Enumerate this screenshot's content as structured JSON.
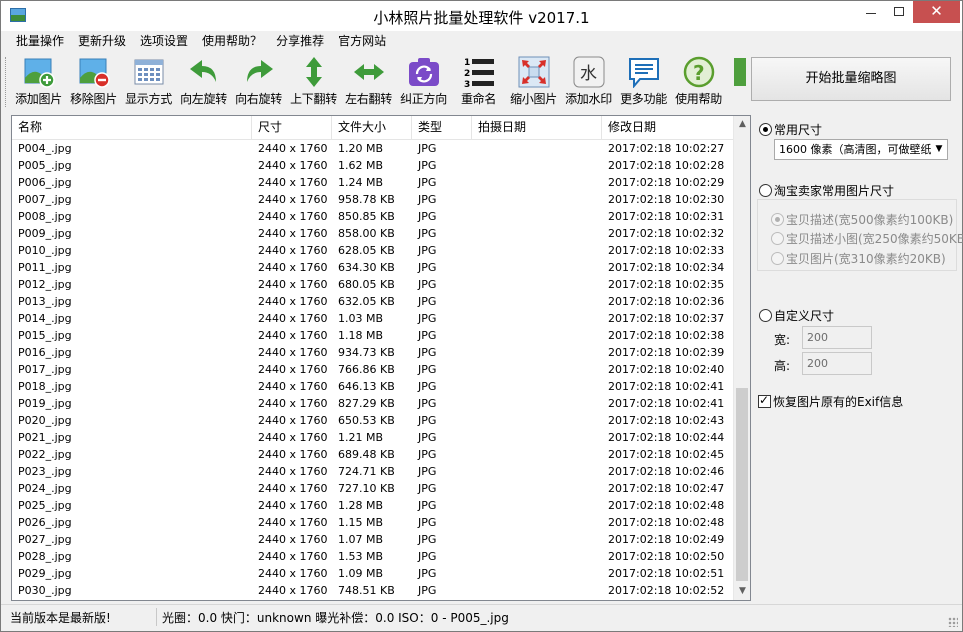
{
  "window": {
    "title": "小林照片批量处理软件 v2017.1"
  },
  "menu": [
    "批量操作",
    "更新升级",
    "选项设置",
    "使用帮助？",
    "分享推荐",
    "官方网站"
  ],
  "toolbar": [
    {
      "label": "添加图片",
      "icon": "add-image-icon"
    },
    {
      "label": "移除图片",
      "icon": "remove-image-icon"
    },
    {
      "label": "显示方式",
      "icon": "view-mode-icon"
    },
    {
      "label": "向左旋转",
      "icon": "rotate-left-icon"
    },
    {
      "label": "向右旋转",
      "icon": "rotate-right-icon"
    },
    {
      "label": "上下翻转",
      "icon": "flip-vertical-icon"
    },
    {
      "label": "左右翻转",
      "icon": "flip-horizontal-icon"
    },
    {
      "label": "纠正方向",
      "icon": "correct-orientation-icon"
    },
    {
      "label": "重命名",
      "icon": "rename-icon"
    },
    {
      "label": "缩小图片",
      "icon": "shrink-image-icon"
    },
    {
      "label": "添加水印",
      "icon": "watermark-icon"
    },
    {
      "label": "更多功能",
      "icon": "more-features-icon"
    },
    {
      "label": "使用帮助",
      "icon": "help-icon"
    }
  ],
  "start_button": "开始批量缩略图",
  "table": {
    "columns": [
      "名称",
      "尺寸",
      "文件大小",
      "类型",
      "拍摄日期",
      "修改日期"
    ],
    "rows": [
      [
        "P004_.jpg",
        "2440 x 1760",
        "1.20 MB",
        "JPG",
        "",
        "2017:02:18 10:02:27"
      ],
      [
        "P005_.jpg",
        "2440 x 1760",
        "1.62 MB",
        "JPG",
        "",
        "2017:02:18 10:02:28"
      ],
      [
        "P006_.jpg",
        "2440 x 1760",
        "1.24 MB",
        "JPG",
        "",
        "2017:02:18 10:02:29"
      ],
      [
        "P007_.jpg",
        "2440 x 1760",
        "958.78 KB",
        "JPG",
        "",
        "2017:02:18 10:02:30"
      ],
      [
        "P008_.jpg",
        "2440 x 1760",
        "850.85 KB",
        "JPG",
        "",
        "2017:02:18 10:02:31"
      ],
      [
        "P009_.jpg",
        "2440 x 1760",
        "858.00 KB",
        "JPG",
        "",
        "2017:02:18 10:02:32"
      ],
      [
        "P010_.jpg",
        "2440 x 1760",
        "628.05 KB",
        "JPG",
        "",
        "2017:02:18 10:02:33"
      ],
      [
        "P011_.jpg",
        "2440 x 1760",
        "634.30 KB",
        "JPG",
        "",
        "2017:02:18 10:02:34"
      ],
      [
        "P012_.jpg",
        "2440 x 1760",
        "680.05 KB",
        "JPG",
        "",
        "2017:02:18 10:02:35"
      ],
      [
        "P013_.jpg",
        "2440 x 1760",
        "632.05 KB",
        "JPG",
        "",
        "2017:02:18 10:02:36"
      ],
      [
        "P014_.jpg",
        "2440 x 1760",
        "1.03 MB",
        "JPG",
        "",
        "2017:02:18 10:02:37"
      ],
      [
        "P015_.jpg",
        "2440 x 1760",
        "1.18 MB",
        "JPG",
        "",
        "2017:02:18 10:02:38"
      ],
      [
        "P016_.jpg",
        "2440 x 1760",
        "934.73 KB",
        "JPG",
        "",
        "2017:02:18 10:02:39"
      ],
      [
        "P017_.jpg",
        "2440 x 1760",
        "766.86 KB",
        "JPG",
        "",
        "2017:02:18 10:02:40"
      ],
      [
        "P018_.jpg",
        "2440 x 1760",
        "646.13 KB",
        "JPG",
        "",
        "2017:02:18 10:02:41"
      ],
      [
        "P019_.jpg",
        "2440 x 1760",
        "827.29 KB",
        "JPG",
        "",
        "2017:02:18 10:02:41"
      ],
      [
        "P020_.jpg",
        "2440 x 1760",
        "650.53 KB",
        "JPG",
        "",
        "2017:02:18 10:02:43"
      ],
      [
        "P021_.jpg",
        "2440 x 1760",
        "1.21 MB",
        "JPG",
        "",
        "2017:02:18 10:02:44"
      ],
      [
        "P022_.jpg",
        "2440 x 1760",
        "689.48 KB",
        "JPG",
        "",
        "2017:02:18 10:02:45"
      ],
      [
        "P023_.jpg",
        "2440 x 1760",
        "724.71 KB",
        "JPG",
        "",
        "2017:02:18 10:02:46"
      ],
      [
        "P024_.jpg",
        "2440 x 1760",
        "727.10 KB",
        "JPG",
        "",
        "2017:02:18 10:02:47"
      ],
      [
        "P025_.jpg",
        "2440 x 1760",
        "1.28 MB",
        "JPG",
        "",
        "2017:02:18 10:02:48"
      ],
      [
        "P026_.jpg",
        "2440 x 1760",
        "1.15 MB",
        "JPG",
        "",
        "2017:02:18 10:02:48"
      ],
      [
        "P027_.jpg",
        "2440 x 1760",
        "1.07 MB",
        "JPG",
        "",
        "2017:02:18 10:02:49"
      ],
      [
        "P028_.jpg",
        "2440 x 1760",
        "1.53 MB",
        "JPG",
        "",
        "2017:02:18 10:02:50"
      ],
      [
        "P029_.jpg",
        "2440 x 1760",
        "1.09 MB",
        "JPG",
        "",
        "2017:02:18 10:02:51"
      ],
      [
        "P030_.jpg",
        "2440 x 1760",
        "748.51 KB",
        "JPG",
        "",
        "2017:02:18 10:02:52"
      ]
    ]
  },
  "panel": {
    "common_size_label": "常用尺寸",
    "common_size_selected": true,
    "size_select_value": "1600 像素（高清图，可做壁纸",
    "taobao_label": "淘宝卖家常用图片尺寸",
    "taobao_selected": false,
    "taobao_options": [
      {
        "label": "宝贝描述(宽500像素约100KB)",
        "checked": true
      },
      {
        "label": "宝贝描述小图(宽250像素约50KB)",
        "checked": false
      },
      {
        "label": "宝贝图片(宽310像素约20KB)",
        "checked": false
      }
    ],
    "custom_size_label": "自定义尺寸",
    "custom_selected": false,
    "width_label": "宽:",
    "width_value": "200",
    "height_label": "高:",
    "height_value": "200",
    "exif_label": "恢复图片原有的Exif信息",
    "exif_checked": true
  },
  "status": {
    "version_msg": "当前版本是最新版!",
    "exif_info": "光圈：0.0  快门：unknown  曝光补偿：0.0  ISO：0  -  P005_.jpg"
  },
  "colors": {
    "close_button": "#c75050",
    "accent_green": "#3e9b3a",
    "accent_purple": "#7b4bc8"
  }
}
